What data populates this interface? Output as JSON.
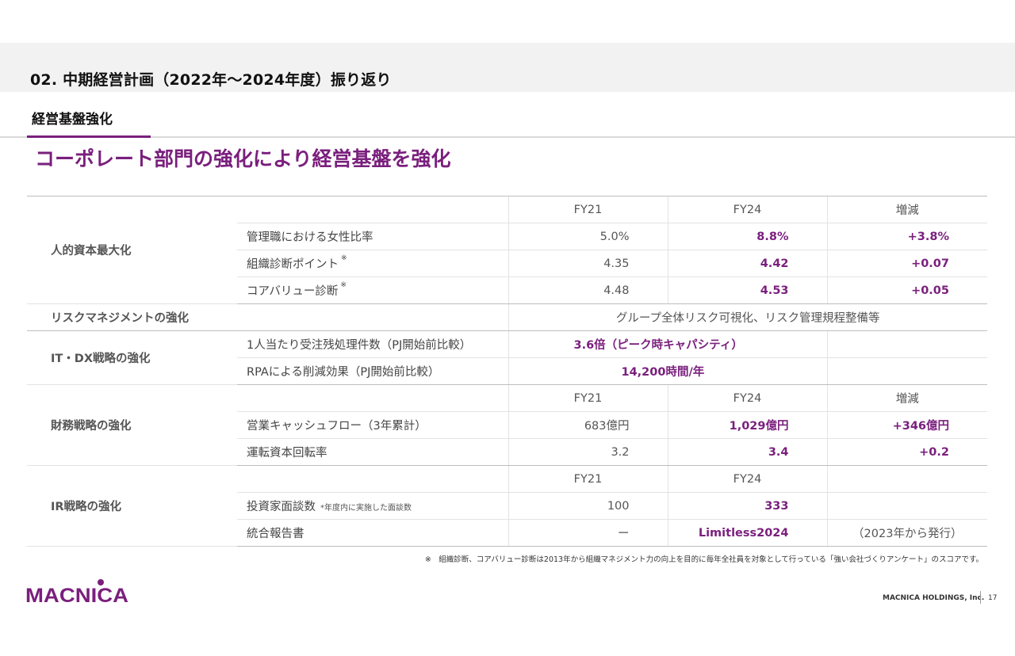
{
  "header": {
    "section_title": "02. 中期経営計画（2022年～2024年度）振り返り",
    "sub_title": "経営基盤強化",
    "headline": "コーポレート部門の強化により経営基盤を強化"
  },
  "table": {
    "col_headers": {
      "fy21": "FY21",
      "fy24": "FY24",
      "change": "増減"
    },
    "human_capital": {
      "category": "人的資本最大化",
      "rows": [
        {
          "item": "管理職における女性比率",
          "fy21": "5.0%",
          "fy24": "8.8%",
          "change": "+3.8%"
        },
        {
          "item": "組織診断ポイント",
          "mark": "※",
          "fy21": "4.35",
          "fy24": "4.42",
          "change": "+0.07"
        },
        {
          "item": "コアバリュー診断",
          "mark": "※",
          "fy21": "4.48",
          "fy24": "4.53",
          "change": "+0.05"
        }
      ]
    },
    "risk": {
      "category": "リスクマネジメントの強化",
      "text": "グループ全体リスク可視化、リスク管理規程整備等"
    },
    "itdx": {
      "category": "IT・DX戦略の強化",
      "rows": [
        {
          "item": "1人当たり受注残処理件数（PJ開始前比較）",
          "value": "3.6倍（ピーク時キャパシティ）"
        },
        {
          "item": "RPAによる削減効果（PJ開始前比較）",
          "value": "14,200時間/年"
        }
      ]
    },
    "finance": {
      "category": "財務戦略の強化",
      "rows": [
        {
          "item": "営業キャッシュフロー（3年累計）",
          "fy21": "683億円",
          "fy24": "1,029億円",
          "change": "+346億円"
        },
        {
          "item": "運転資本回転率",
          "fy21": "3.2",
          "fy24": "3.4",
          "change": "+0.2"
        }
      ]
    },
    "ir": {
      "category": "IR戦略の強化",
      "rows": [
        {
          "item": "投資家面談数",
          "note": "*年度内に実施した面談数",
          "fy21": "100",
          "fy24": "333",
          "change": ""
        },
        {
          "item": "統合報告書",
          "fy21": "ー",
          "fy24": "Limitless2024",
          "change": "（2023年から発行）"
        }
      ]
    }
  },
  "footnote": "※　組織診断、コアバリュー診断は2013年から組織マネジメント力の向上を目的に毎年全社員を対象として行っている「強い会社づくりアンケート」のスコアです。",
  "footer": {
    "logo_text": "MACNICA",
    "company": "MACNICA HOLDINGS, Inc.",
    "page_number": "17"
  },
  "colors": {
    "accent": "#7a1f7d",
    "band": "#f2f2f2",
    "rule": "#bdbdbd"
  }
}
